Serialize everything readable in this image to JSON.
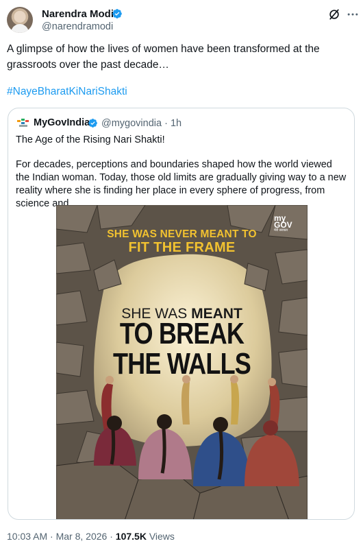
{
  "post": {
    "author_name": "Narendra Modi",
    "author_handle": "@narendramodi",
    "text": "A glimpse of how the lives of women have been transformed at the grassroots over the past decade…",
    "hashtag": "#NayeBharatKiNariShakti"
  },
  "quoted_post": {
    "author_name": "MyGovIndia",
    "author_handle": "@mygovindia",
    "separator": "·",
    "time": "1h",
    "title_line": "The Age of the Rising Nari Shakti!",
    "body": "For decades, perceptions and boundaries shaped how the world viewed the Indian woman. Today, those old limits are gradually giving way to a new reality where she is finding her place in every sphere of progress, from science and …",
    "poster": {
      "brand_line1": "my",
      "brand_line2": "GOV",
      "brand_line3": "मेरी सरकार",
      "headline_top": "SHE WAS NEVER MEANT TO",
      "headline_emph": "FIT THE FRAME",
      "meant_prefix": "SHE WAS ",
      "meant_bold": "MEANT",
      "break_line1": "TO BREAK",
      "break_line2": "THE WALLS"
    }
  },
  "meta": {
    "time": "10:03 AM",
    "separator": "·",
    "date": "Mar 8, 2026",
    "views_count": "107.5K",
    "views_label": "Views"
  },
  "icons": {
    "verified": "verified-badge-icon",
    "grok": "grok-icon",
    "more": "more-icon"
  },
  "colors": {
    "accent": "#1d9bf0",
    "headline_yellow": "#f2c230",
    "secondary_text": "#536471"
  }
}
